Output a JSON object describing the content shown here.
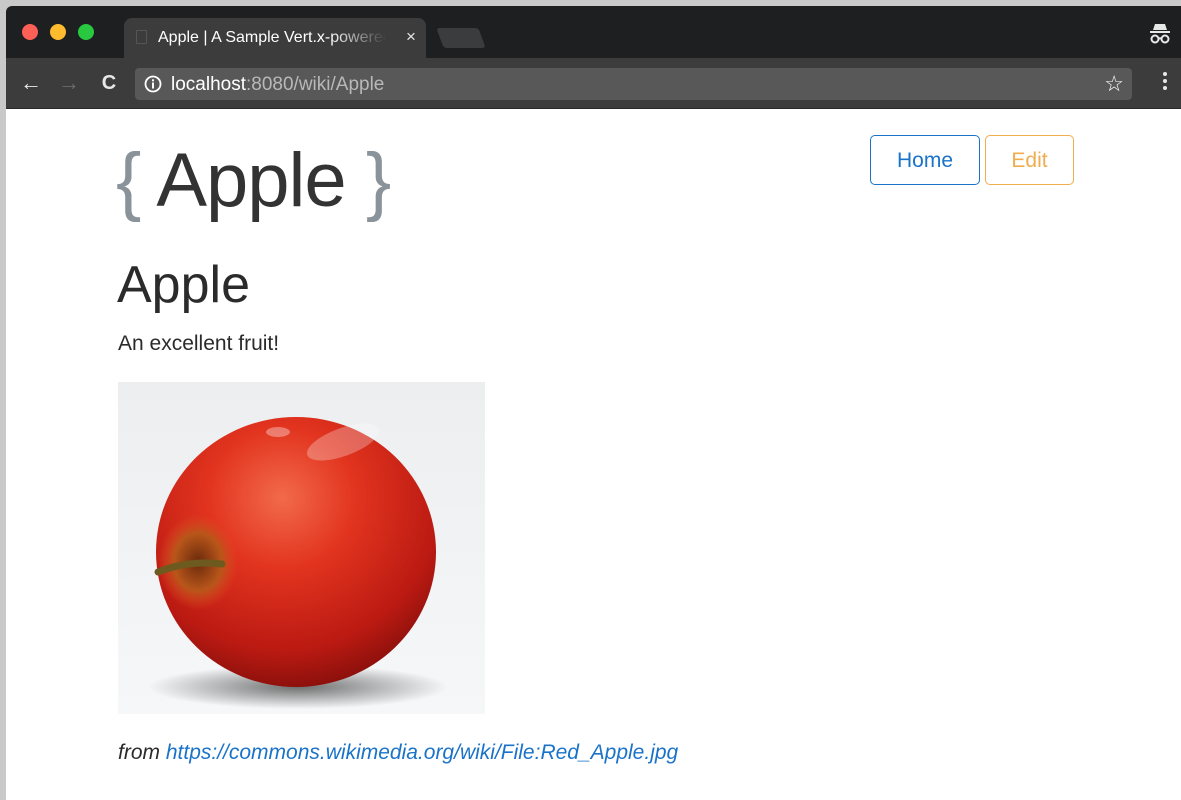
{
  "browser": {
    "tab": {
      "title": "Apple | A Sample Vert.x-powered Wiki",
      "close_glyph": "×"
    },
    "toolbar": {
      "back_glyph": "←",
      "forward_glyph": "→",
      "reload_glyph": "C",
      "url_host": "localhost",
      "url_rest": ":8080/wiki/Apple",
      "bookmark_glyph": "☆"
    },
    "icons": [
      "info-icon",
      "star-icon",
      "incognito-icon",
      "more-icon"
    ]
  },
  "page": {
    "brand": {
      "open": "{",
      "name": " Apple ",
      "close": "}"
    },
    "nav": {
      "home_label": "Home",
      "edit_label": "Edit"
    },
    "title": "Apple",
    "description": "An excellent fruit!",
    "image_alt": "Red apple photo",
    "caption": {
      "prefix": "from ",
      "link_text": "https://commons.wikimedia.org/wiki/File:Red_Apple.jpg"
    }
  },
  "colors": {
    "primary": "#1a73c8",
    "warning": "#f0ad4e",
    "text": "#2b2b2b",
    "brace": "#8a939a"
  }
}
